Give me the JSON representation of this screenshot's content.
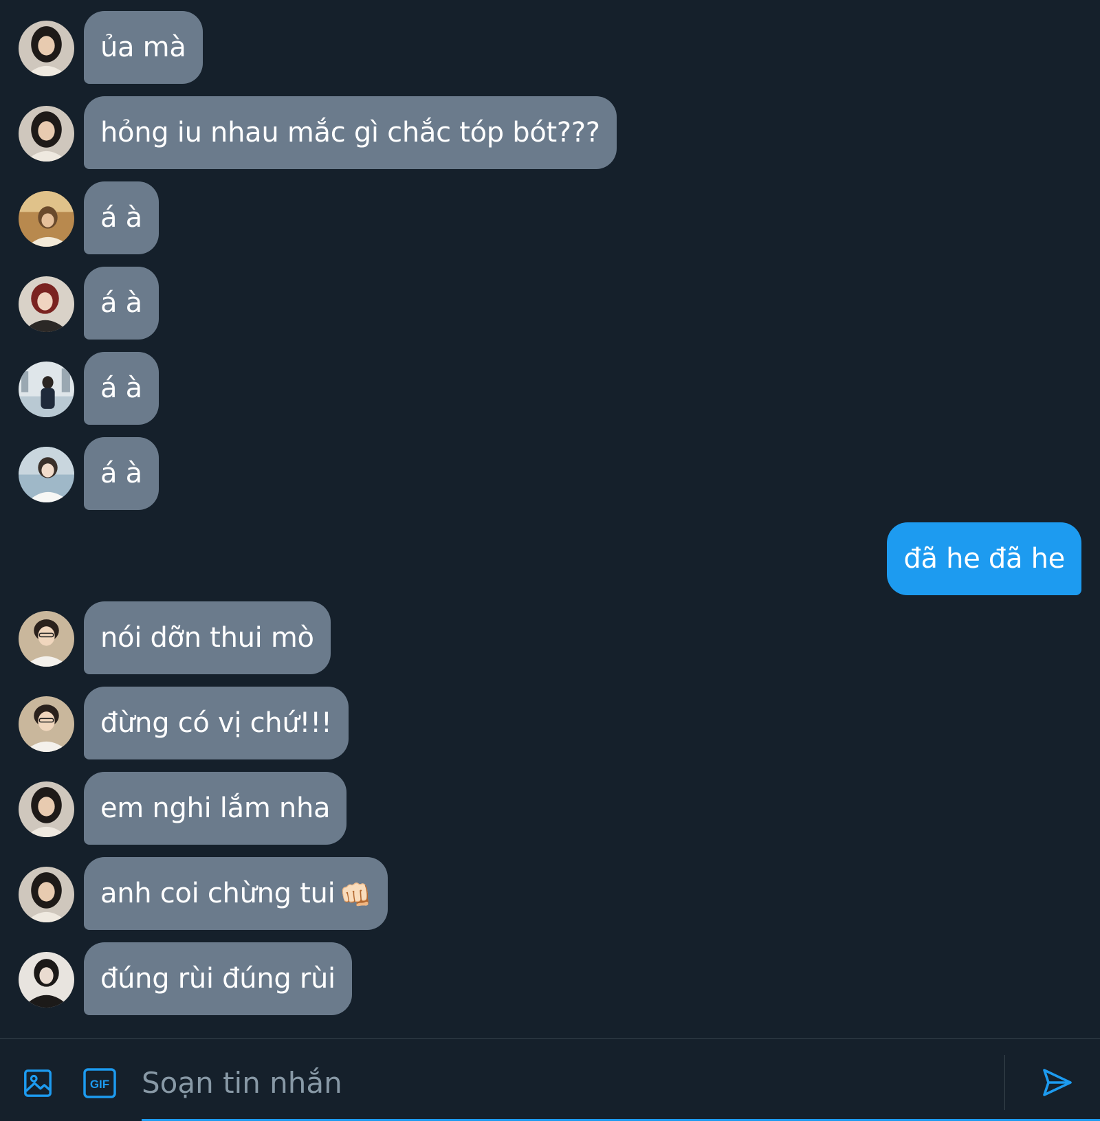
{
  "messages": [
    {
      "from": "them",
      "avatar": "avatar-girl-long-hair",
      "text": "ủa mà"
    },
    {
      "from": "them",
      "avatar": "avatar-girl-long-hair",
      "text": "hỏng iu nhau mắc gì chắc tóp bót???"
    },
    {
      "from": "them",
      "avatar": "avatar-boy-warm-tone",
      "text": "á à"
    },
    {
      "from": "them",
      "avatar": "avatar-girl-red-hair",
      "text": "á à"
    },
    {
      "from": "them",
      "avatar": "avatar-person-outdoor",
      "text": "á à"
    },
    {
      "from": "them",
      "avatar": "avatar-boy-white-shirt",
      "text": "á à"
    },
    {
      "from": "me",
      "text": "đã he đã he"
    },
    {
      "from": "them",
      "avatar": "avatar-boy-glasses",
      "text": "nói dỡn thui mò"
    },
    {
      "from": "them",
      "avatar": "avatar-boy-glasses",
      "text": "đừng có vị chứ!!!"
    },
    {
      "from": "them",
      "avatar": "avatar-girl-long-hair",
      "text": "em nghi lắm nha"
    },
    {
      "from": "them",
      "avatar": "avatar-girl-long-hair",
      "text": "anh coi chừng tui",
      "emoji": "👊🏻"
    },
    {
      "from": "them",
      "avatar": "avatar-boy-dark-portrait",
      "text": "đúng rùi đúng rùi"
    }
  ],
  "composer": {
    "placeholder": "Soạn tin nhắn",
    "media_icon": "image-icon",
    "gif_label": "GIF",
    "send_icon": "send-icon"
  },
  "colors": {
    "background": "#15202b",
    "incoming_bubble": "#6b7b8c",
    "outgoing_bubble": "#1d9bf0",
    "accent": "#1d9bf0",
    "placeholder": "#8899a6"
  }
}
